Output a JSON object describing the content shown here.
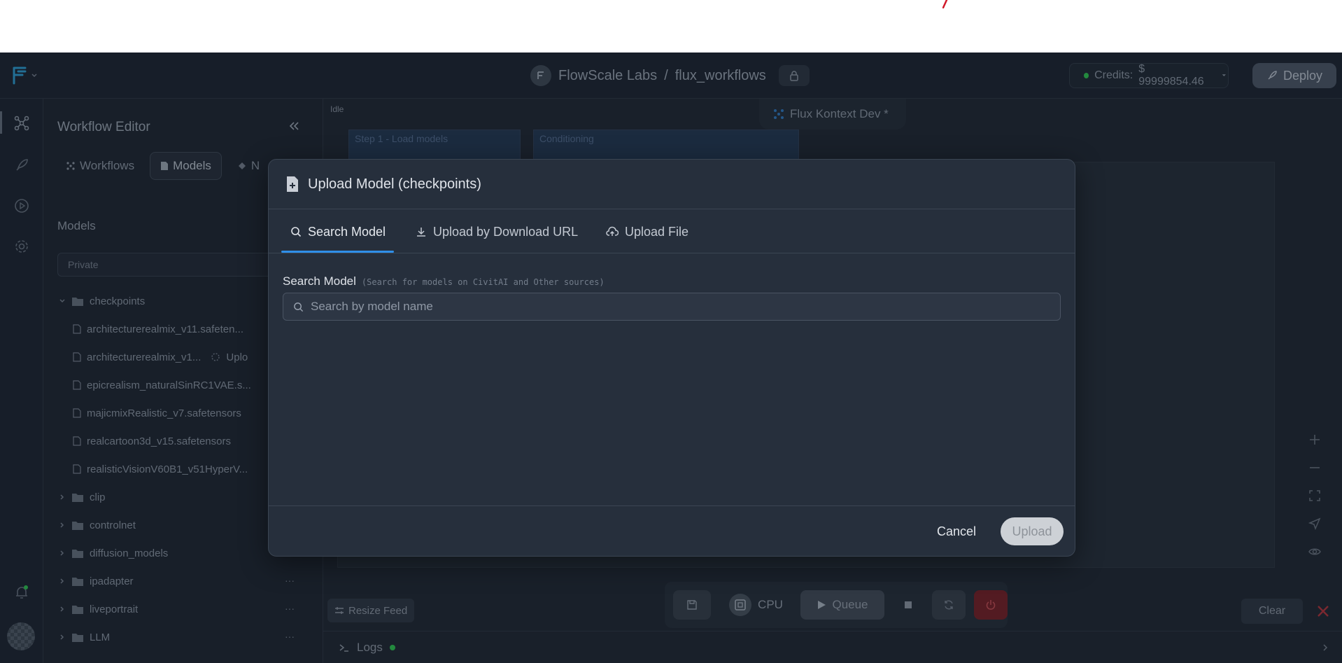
{
  "header": {
    "org": "FlowScale Labs",
    "separator": "/",
    "project": "flux_workflows",
    "credits_label": "Credits:",
    "credits_value": "$ 99999854.46",
    "deploy_label": "Deploy"
  },
  "sidebar": {
    "title": "Workflow Editor",
    "tabs": [
      "Workflows",
      "Models",
      "N"
    ],
    "models_heading": "Models",
    "filter_value": "Private",
    "tree": {
      "checkpoints_folder": "checkpoints",
      "files": [
        "architecturerealmix_v11.safeten...",
        "architecturerealmix_v1...",
        "epicrealism_naturalSinRC1VAE.s...",
        "majicmixRealistic_v7.safetensors",
        "realcartoon3d_v15.safetensors",
        "realisticVisionV60B1_v51HyperV..."
      ],
      "uploading_label": "Uplo",
      "folders": [
        "clip",
        "controlnet",
        "diffusion_models",
        "ipadapter",
        "liveportrait",
        "LLM"
      ],
      "more": "···"
    }
  },
  "canvas": {
    "status": "Idle",
    "workflow_tab": "Flux Kontext Dev *",
    "node_1": "Step 1 - Load models",
    "node_2": "Conditioning",
    "resize_feed": "Resize Feed",
    "cpu_label": "CPU",
    "queue_label": "Queue",
    "clear_label": "Clear",
    "logs_label": "Logs"
  },
  "modal": {
    "title": "Upload Model (checkpoints)",
    "tabs": {
      "search": "Search Model",
      "url": "Upload by Download URL",
      "file": "Upload File"
    },
    "field_label": "Search Model",
    "field_hint": "(Search for models on CivitAI and Other sources)",
    "search_placeholder": "Search by model name",
    "cancel_label": "Cancel",
    "upload_label": "Upload"
  },
  "colors": {
    "accent": "#2f8fe8",
    "modal_bg": "#262f3c",
    "app_bg": "#1c2430",
    "status_green": "#2bb24c",
    "danger": "#a1303a"
  }
}
